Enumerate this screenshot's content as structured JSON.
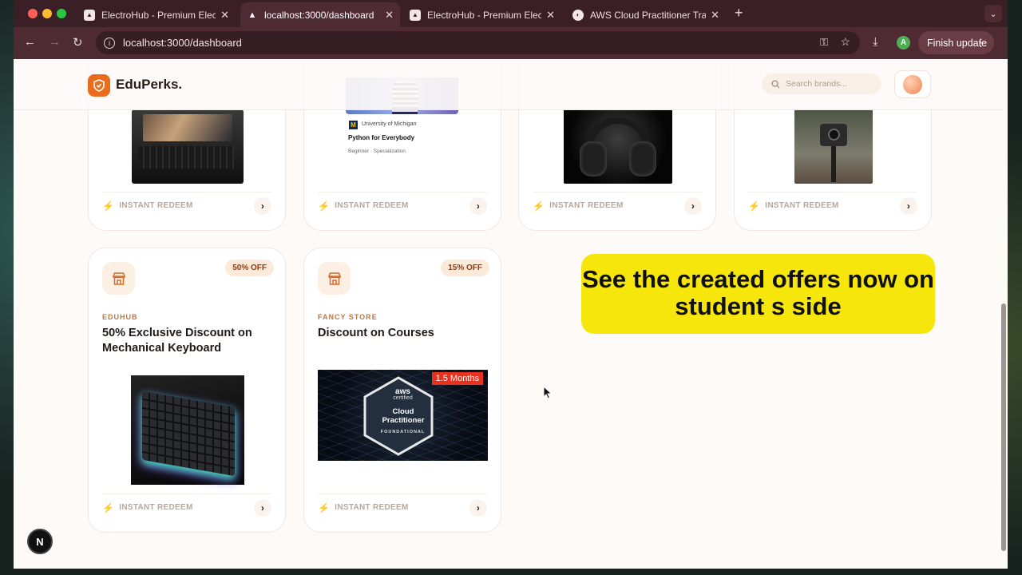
{
  "browser": {
    "tabs": [
      {
        "title": "ElectroHub - Premium Electro",
        "favicon": "vercel-icon"
      },
      {
        "title": "localhost:3000/dashboard",
        "favicon": "triangle-icon"
      },
      {
        "title": "ElectroHub - Premium Electro",
        "favicon": "vercel-icon"
      },
      {
        "title": "AWS Cloud Practitioner Traini",
        "favicon": "udemy-icon"
      }
    ],
    "url": "localhost:3000/dashboard",
    "profile_initial": "A",
    "finish_update": "Finish update"
  },
  "header": {
    "logo": "EduPerks.",
    "search_placeholder": "Search brands..."
  },
  "top_cards": [
    {
      "image": "laptop",
      "cta": "INSTANT REDEEM"
    },
    {
      "image": "course",
      "cta": "INSTANT REDEEM",
      "course": {
        "university": "University of Michigan",
        "name": "Python for Everybody",
        "meta": "Beginner · Specialization"
      }
    },
    {
      "image": "headphones",
      "cta": "INSTANT REDEEM"
    },
    {
      "image": "action-camera",
      "cta": "INSTANT REDEEM"
    }
  ],
  "offers": [
    {
      "brand": "EDUHUB",
      "title": "50% Exclusive Discount on Mechanical Keyboard",
      "badge": "50% OFF",
      "image": "keyboard",
      "cta": "INSTANT REDEEM"
    },
    {
      "brand": "FANCY STORE",
      "title": "Discount on Courses",
      "badge": "15% OFF",
      "image": "aws-cert",
      "cta": "INSTANT REDEEM",
      "image_text": {
        "duration": "1.5 Months",
        "aws": "aws",
        "certified": "certified",
        "name": "Cloud Practitioner",
        "level": "FOUNDATIONAL"
      }
    }
  ],
  "overlay_caption": "See the created offers now on student s side",
  "nextjs_badge": "N",
  "colors": {
    "accent": "#ea6d1e",
    "badge_bg": "#fde9d8",
    "caption_bg": "#f7e60c",
    "tabbar": "#3a1f26"
  }
}
